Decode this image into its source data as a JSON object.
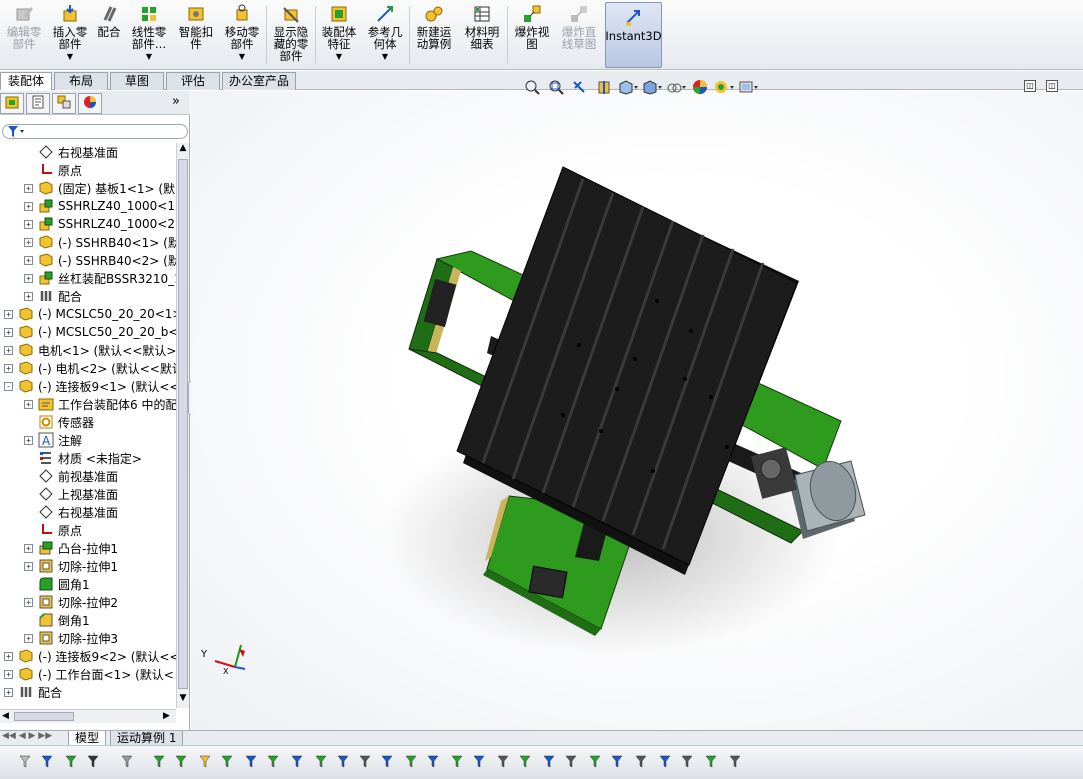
{
  "ribbon": {
    "buttons": [
      {
        "label": "编辑零\n部件",
        "icon": "edit-part-icon",
        "disabled": true,
        "dropdown": false
      },
      {
        "label": "插入零\n部件",
        "icon": "insert-component-icon",
        "disabled": false,
        "dropdown": true
      },
      {
        "label": "配合",
        "icon": "mate-icon",
        "disabled": false,
        "dropdown": false
      },
      {
        "label": "线性零\n部件…",
        "icon": "linear-pattern-icon",
        "disabled": false,
        "dropdown": true
      },
      {
        "label": "智能扣\n件",
        "icon": "smart-fastener-icon",
        "disabled": false,
        "dropdown": false
      },
      {
        "label": "移动零\n部件",
        "icon": "move-component-icon",
        "disabled": false,
        "dropdown": true
      },
      {
        "label": "显示隐\n藏的零\n部件",
        "icon": "show-hidden-icon",
        "disabled": false,
        "dropdown": false
      },
      {
        "label": "装配体\n特征",
        "icon": "assembly-feature-icon",
        "disabled": false,
        "dropdown": true
      },
      {
        "label": "参考几\n何体",
        "icon": "reference-geometry-icon",
        "disabled": false,
        "dropdown": true
      },
      {
        "label": "新建运\n动算例",
        "icon": "motion-study-icon",
        "disabled": false,
        "dropdown": false
      },
      {
        "label": "材料明\n细表",
        "icon": "bom-icon",
        "disabled": false,
        "dropdown": false
      },
      {
        "label": "爆炸视\n图",
        "icon": "exploded-view-icon",
        "disabled": false,
        "dropdown": false
      },
      {
        "label": "爆炸直\n线草图",
        "icon": "explode-line-sketch-icon",
        "disabled": true,
        "dropdown": false
      },
      {
        "label": "Instant3D",
        "icon": "instant3d-icon",
        "disabled": false,
        "dropdown": false
      }
    ]
  },
  "tabs": [
    "装配体",
    "布局",
    "草图",
    "评估",
    "办公室产品"
  ],
  "panel_tabs": [
    "feature-manager-icon",
    "property-manager-icon",
    "configuration-manager-icon",
    "appearance-icon"
  ],
  "panel_expand": "»",
  "tree": [
    {
      "label": "右视基准面",
      "icon": "plane-icon",
      "indent": 1,
      "expander": ""
    },
    {
      "label": "原点",
      "icon": "origin-icon",
      "indent": 1,
      "expander": ""
    },
    {
      "label": "(固定) 基板1<1> (默",
      "icon": "part-icon",
      "indent": 1,
      "expander": "+"
    },
    {
      "label": "SSHRLZ40_1000<1> (S",
      "icon": "subassembly-icon",
      "indent": 1,
      "expander": "+"
    },
    {
      "label": "SSHRLZ40_1000<2> (S",
      "icon": "subassembly-icon",
      "indent": 1,
      "expander": "+"
    },
    {
      "label": "(-) SSHRB40<1> (默认",
      "icon": "part-icon",
      "indent": 1,
      "expander": "+"
    },
    {
      "label": "(-) SSHRB40<2> (默认",
      "icon": "part-icon",
      "indent": 1,
      "expander": "+"
    },
    {
      "label": "丝杠装配BSSR3210_110",
      "icon": "subassembly-icon",
      "indent": 1,
      "expander": "+"
    },
    {
      "label": "配合",
      "icon": "mates-icon",
      "indent": 1,
      "expander": "+"
    },
    {
      "label": "(-) MCSLC50_20_20<1> (",
      "icon": "part-icon",
      "indent": 0,
      "expander": "+"
    },
    {
      "label": "(-) MCSLC50_20_20_b<1>",
      "icon": "part-icon",
      "indent": 0,
      "expander": "+"
    },
    {
      "label": "电机<1> (默认<<默认>_显",
      "icon": "part-icon",
      "indent": 0,
      "expander": "+"
    },
    {
      "label": "(-) 电机<2> (默认<<默认",
      "icon": "part-icon",
      "indent": 0,
      "expander": "+"
    },
    {
      "label": "(-) 连接板9<1> (默认<<",
      "icon": "part-icon",
      "indent": 0,
      "expander": "-"
    },
    {
      "label": "工作台装配体6 中的配",
      "icon": "history-folder-icon",
      "indent": 1,
      "expander": "+"
    },
    {
      "label": "传感器",
      "icon": "sensor-icon",
      "indent": 1,
      "expander": ""
    },
    {
      "label": "注解",
      "icon": "annotation-icon",
      "indent": 1,
      "expander": "+"
    },
    {
      "label": "材质 <未指定>",
      "icon": "material-icon",
      "indent": 1,
      "expander": ""
    },
    {
      "label": "前视基准面",
      "icon": "plane-icon",
      "indent": 1,
      "expander": ""
    },
    {
      "label": "上视基准面",
      "icon": "plane-icon",
      "indent": 1,
      "expander": ""
    },
    {
      "label": "右视基准面",
      "icon": "plane-icon",
      "indent": 1,
      "expander": ""
    },
    {
      "label": "原点",
      "icon": "origin-icon",
      "indent": 1,
      "expander": ""
    },
    {
      "label": "凸台-拉伸1",
      "icon": "boss-extrude-icon",
      "indent": 1,
      "expander": "+"
    },
    {
      "label": "切除-拉伸1",
      "icon": "cut-extrude-icon",
      "indent": 1,
      "expander": "+"
    },
    {
      "label": "圆角1",
      "icon": "fillet-icon",
      "indent": 1,
      "expander": ""
    },
    {
      "label": "切除-拉伸2",
      "icon": "cut-extrude-icon",
      "indent": 1,
      "expander": "+"
    },
    {
      "label": "倒角1",
      "icon": "chamfer-icon",
      "indent": 1,
      "expander": ""
    },
    {
      "label": "切除-拉伸3",
      "icon": "cut-extrude-icon",
      "indent": 1,
      "expander": "+"
    },
    {
      "label": "(-) 连接板9<2> (默认<<",
      "icon": "part-icon",
      "indent": 0,
      "expander": "+"
    },
    {
      "label": "(-) 工作台面<1> (默认<",
      "icon": "part-icon",
      "indent": 0,
      "expander": "+"
    },
    {
      "label": "配合",
      "icon": "mates-icon",
      "indent": 0,
      "expander": "+"
    }
  ],
  "bottom_tabs": [
    "模型",
    "运动算例 1"
  ],
  "triad": {
    "y_label": "Y",
    "x_label": "X"
  },
  "colors": {
    "rail_green": "#2f9b1e",
    "table_black": "#1c1c1c",
    "motor_gray": "#9aa3a8"
  }
}
